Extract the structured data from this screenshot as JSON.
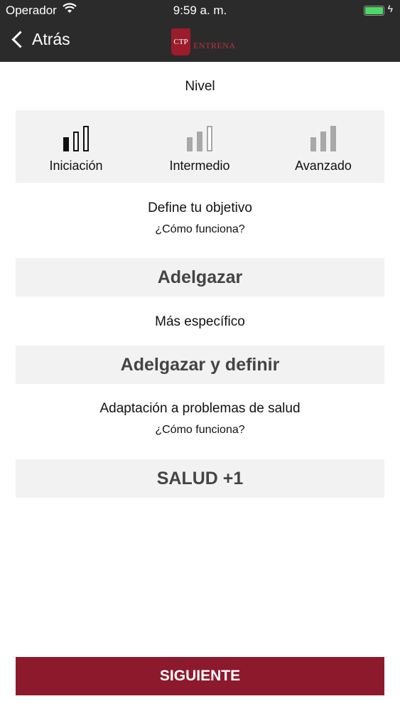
{
  "status_bar": {
    "carrier": "Operador",
    "time": "9:59 a. m.",
    "battery_level": 1.0
  },
  "nav": {
    "back_label": "Atrás",
    "logo_mark": "CTP",
    "logo_text": "ENTRENA"
  },
  "level": {
    "title": "Nivel",
    "options": [
      {
        "label": "Iniciación",
        "selected": true
      },
      {
        "label": "Intermedio",
        "selected": false
      },
      {
        "label": "Avanzado",
        "selected": false
      }
    ]
  },
  "objective": {
    "title": "Define tu objetivo",
    "help": "¿Cómo funciona?",
    "value": "Adelgazar"
  },
  "specific": {
    "title": "Más específico",
    "value": "Adelgazar y definir"
  },
  "health": {
    "title": "Adaptación a problemas de salud",
    "help": "¿Cómo funciona?",
    "value": "SALUD +1"
  },
  "next_button": "SIGUIENTE",
  "colors": {
    "nav_bg": "#2b2b2b",
    "accent": "#8d1a2c",
    "panel": "#f2f2f2",
    "battery": "#4cd964"
  }
}
